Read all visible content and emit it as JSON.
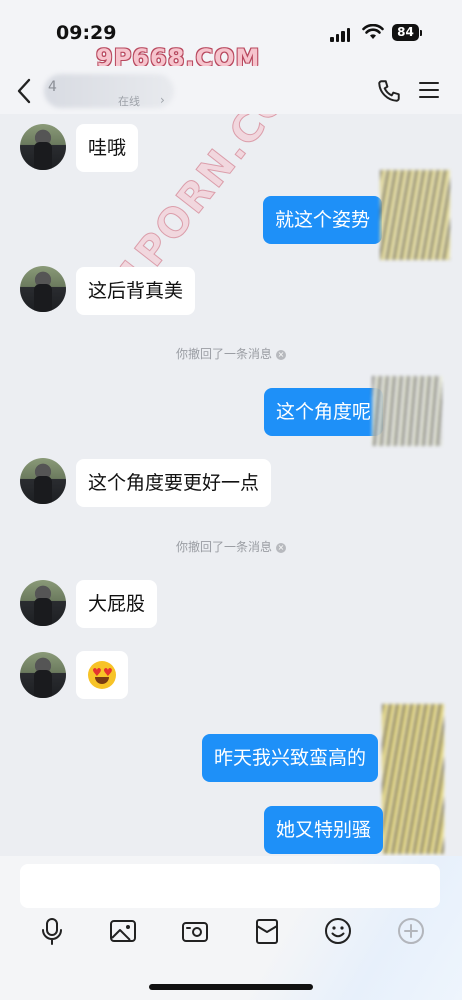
{
  "status_bar": {
    "time": "09:29",
    "battery": "84"
  },
  "watermarks": {
    "top": "9P668.COM",
    "diagonal": "91PORN.COM"
  },
  "nav": {
    "count": "4",
    "subtitle": "在线"
  },
  "messages": [
    {
      "side": "in",
      "text": "哇哦"
    },
    {
      "side": "out",
      "text": "就这个姿势"
    },
    {
      "side": "in",
      "text": "这后背真美"
    },
    {
      "side": "system",
      "text": "你撤回了一条消息"
    },
    {
      "side": "out",
      "text": "这个角度呢"
    },
    {
      "side": "in",
      "text": "这个角度要更好一点"
    },
    {
      "side": "system",
      "text": "你撤回了一条消息"
    },
    {
      "side": "in",
      "text": "大屁股"
    },
    {
      "side": "in",
      "emoji": "heart-eyes"
    },
    {
      "side": "out",
      "text": "昨天我兴致蛮高的"
    },
    {
      "side": "out",
      "text": "她又特别骚"
    }
  ],
  "input": {
    "placeholder": ""
  },
  "toolbar": [
    "mic-icon",
    "image-icon",
    "camera-icon",
    "red-packet-icon",
    "emoji-icon",
    "plus-icon"
  ],
  "colors": {
    "outgoing": "#1e90f8",
    "incoming": "#ffffff",
    "background": "#eceef2"
  }
}
